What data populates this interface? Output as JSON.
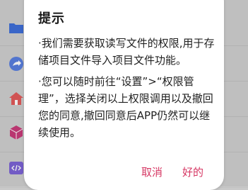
{
  "dialog": {
    "title": "提示",
    "message1": "·我们需要获取读写文件的权限,用于存储项目文件导入项目文件功能。",
    "message2": "·您可以随时前往“设置”>“权限管理”，选择关闭以上权限调用以及撤回您的同意,撤回同意后APP仍然可以继续使用。",
    "cancel_label": "取消",
    "ok_label": "好的"
  },
  "colors": {
    "accent": "#d63864",
    "icon_folder": "#3f6fd9",
    "icon_share": "#5a7fe0",
    "icon_home": "#e25b5b",
    "icon_box": "#c93b7a",
    "icon_code": "#7c63d6"
  },
  "background_icons": [
    "folder-icon",
    "share-icon",
    "home-icon",
    "box-icon",
    "code-icon"
  ]
}
